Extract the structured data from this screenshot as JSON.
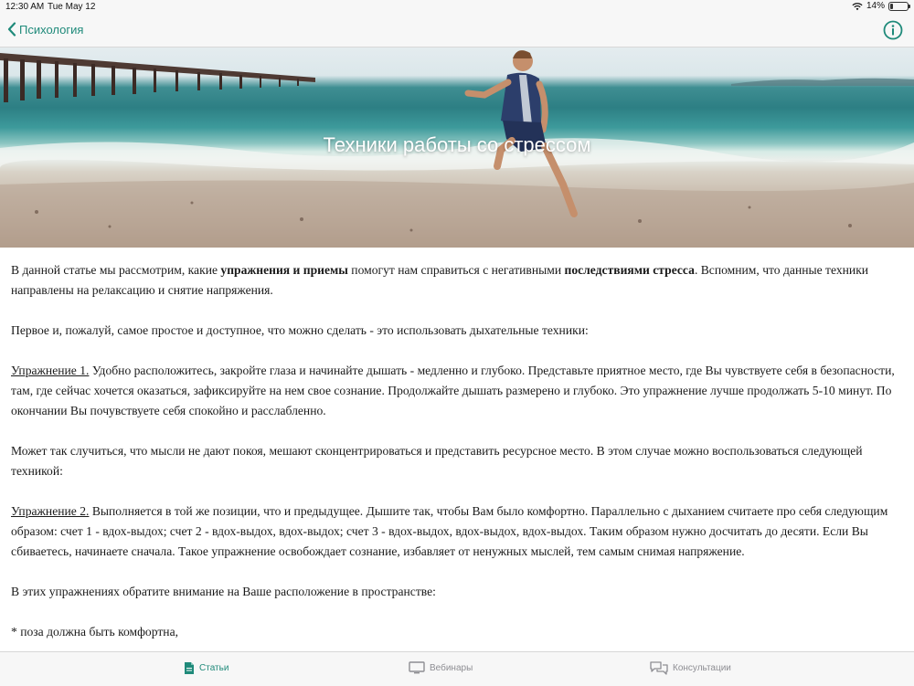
{
  "status_bar": {
    "time": "12:30 AM",
    "date": "Tue May 12",
    "battery_percent": "14%",
    "battery_level": 0.14
  },
  "nav": {
    "back_label": "Психология",
    "back_icon": "chevron-left-icon",
    "info_icon": "info-icon"
  },
  "hero": {
    "title": "Техники работы со стрессом"
  },
  "article": {
    "p1": {
      "a": "В данной статье мы рассмотрим, какие ",
      "b": "упражнения и приемы",
      "c": " помогут нам справиться с негативными ",
      "d": "последствиями стресса",
      "e": ". Вспомним, что данные техники направлены на релаксацию и снятие напряжения."
    },
    "p2": "Первое и, пожалуй, самое простое и доступное, что можно сделать - это использовать дыхательные техники:",
    "p3": {
      "label": "Упражнение 1.",
      "text": " Удобно расположитесь, закройте глаза и начинайте дышать - медленно и глубоко. Представьте приятное место, где Вы чувствуете себя в безопасности, там, где сейчас хочется оказаться, зафиксируйте на нем свое сознание. Продолжайте дышать размерено и глубоко. Это упражнение лучше продолжать 5-10 минут. По окончании Вы почувствуете себя спокойно и расслабленно."
    },
    "p4": "Может так случиться, что мысли не дают покоя, мешают сконцентрироваться и представить ресурсное место. В этом случае можно воспользоваться следующей техникой:",
    "p5": {
      "label": "Упражнение 2.",
      "text": " Выполняется в той же позиции, что и предыдущее. Дышите так, чтобы Вам было комфортно. Параллельно с дыханием считаете про себя следующим образом: счет 1 - вдох-выдох; счет 2 - вдох-выдох, вдох-выдох; счет 3 - вдох-выдох, вдох-выдох, вдох-выдох. Таким образом нужно досчитать до десяти. Если Вы сбиваетесь, начинаете сначала. Такое упражнение освобождает сознание, избавляет от ненужных мыслей, тем самым снимая напряжение."
    },
    "p6": "В этих упражнениях обратите внимание на Ваше расположение в пространстве:",
    "p7": "* поза должна быть комфортна,"
  },
  "tabs": [
    {
      "label": "Статьи",
      "icon": "document-icon",
      "active": true
    },
    {
      "label": "Вебинары",
      "icon": "monitor-icon",
      "active": false
    },
    {
      "label": "Консультации",
      "icon": "chat-bubbles-icon",
      "active": false
    }
  ],
  "colors": {
    "accent": "#1f8a7a",
    "inactive": "#8e8e93",
    "bar_background": "#f7f7f7"
  }
}
